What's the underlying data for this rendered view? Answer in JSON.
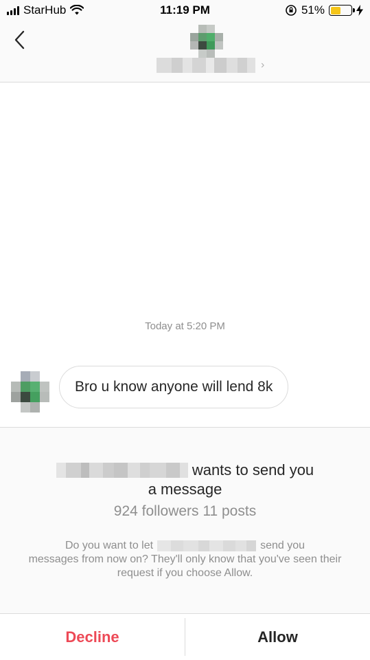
{
  "status_bar": {
    "carrier": "StarHub",
    "time": "11:19 PM",
    "battery_percent": "51%",
    "battery_level": 0.51,
    "icons": [
      "signal-icon",
      "wifi-icon",
      "orientation-lock-icon",
      "battery-icon",
      "charging-icon"
    ]
  },
  "header": {
    "back_icon": "back-chevron-icon",
    "chevron": "›"
  },
  "conversation": {
    "timestamp": "Today at 5:20 PM",
    "messages": [
      {
        "sender": "other",
        "text": "Bro u know anyone will lend 8k"
      }
    ]
  },
  "request": {
    "title_suffix": "wants to send you",
    "title_line2": "a message",
    "stats": "924 followers 11 posts",
    "desc_prefix": "Do you want to let",
    "desc_suffix": "send you",
    "desc_rest": "messages from now on? They'll only know that you've seen their request if you choose Allow."
  },
  "actions": {
    "decline_label": "Decline",
    "allow_label": "Allow"
  },
  "colors": {
    "decline": "#ed4956",
    "battery_fill": "#f5c518",
    "muted_text": "#8e8e8e"
  }
}
